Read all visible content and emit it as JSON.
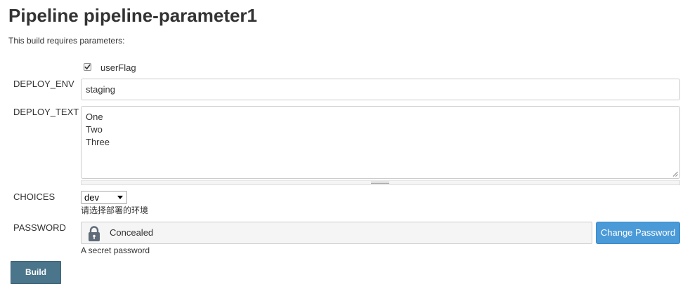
{
  "page": {
    "title": "Pipeline pipeline-parameter1",
    "subtitle": "This build requires parameters:"
  },
  "params": {
    "user_flag": {
      "label": "userFlag",
      "checked": true
    },
    "deploy_env": {
      "label": "DEPLOY_ENV",
      "value": "staging"
    },
    "deploy_text": {
      "label": "DEPLOY_TEXT",
      "lines": [
        "One",
        "Two",
        "Three"
      ]
    },
    "choices": {
      "label": "CHOICES",
      "selected": "dev",
      "help": "请选择部署的环境"
    },
    "password": {
      "label": "PASSWORD",
      "value": "Concealed",
      "help": "A secret password",
      "change_label": "Change Password"
    }
  },
  "actions": {
    "build_label": "Build"
  },
  "colors": {
    "change_button": "#4b9ad8",
    "build_button": "#4b758b",
    "password_field_bg": "#f5f5f5"
  },
  "icons": {
    "checkbox": "check-icon",
    "password": "lock-icon"
  }
}
